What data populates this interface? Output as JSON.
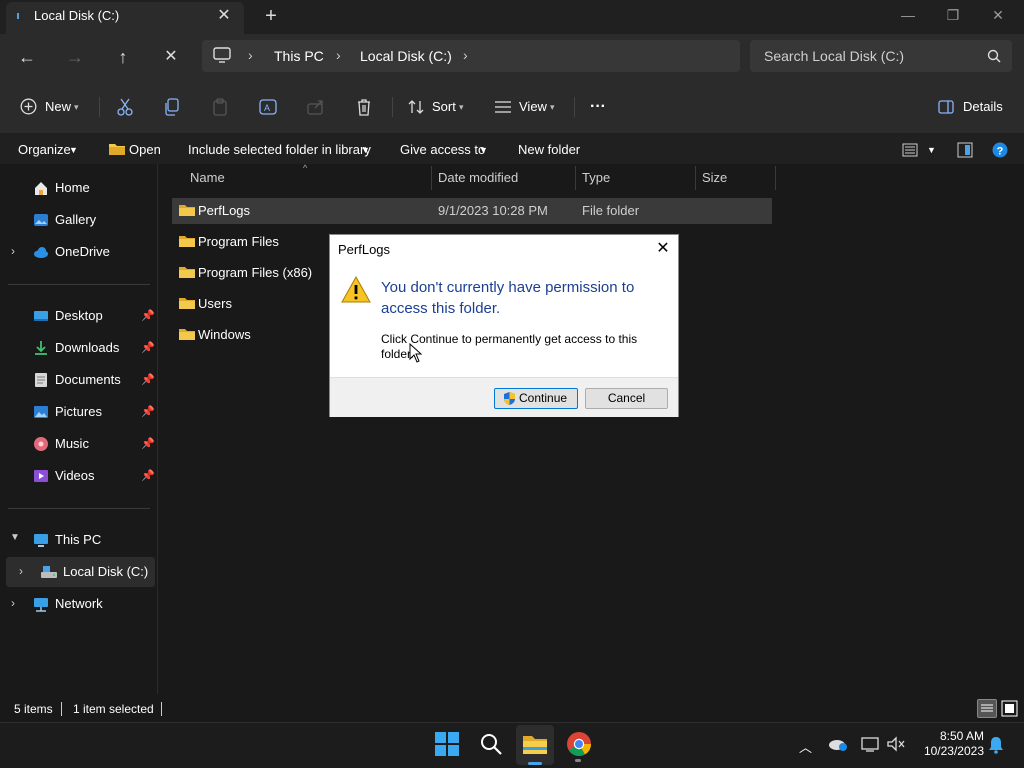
{
  "window": {
    "tab_title": "Local Disk (C:)",
    "new_tab": "+"
  },
  "address": {
    "crumbs": [
      "This PC",
      "Local Disk (C:)"
    ],
    "search_placeholder": "Search Local Disk (C:)"
  },
  "command_bar": {
    "new_label": "New",
    "sort_label": "Sort",
    "view_label": "View",
    "more_label": "···",
    "details_label": "Details"
  },
  "legacy_toolbar": {
    "organize": "Organize",
    "open": "Open",
    "include_in_library": "Include selected folder in library",
    "give_access": "Give access to",
    "new_folder": "New folder"
  },
  "sidebar": {
    "top": [
      {
        "label": "Home",
        "icon": "home-icon"
      },
      {
        "label": "Gallery",
        "icon": "gallery-icon"
      },
      {
        "label": "OneDrive",
        "icon": "onedrive-icon"
      }
    ],
    "pinned": [
      {
        "label": "Desktop",
        "icon": "desktop-icon"
      },
      {
        "label": "Downloads",
        "icon": "downloads-icon"
      },
      {
        "label": "Documents",
        "icon": "documents-icon"
      },
      {
        "label": "Pictures",
        "icon": "pictures-icon"
      },
      {
        "label": "Music",
        "icon": "music-icon"
      },
      {
        "label": "Videos",
        "icon": "videos-icon"
      }
    ],
    "tree": [
      {
        "label": "This PC",
        "icon": "this-pc-icon"
      },
      {
        "label": "Local Disk (C:)",
        "icon": "drive-icon"
      },
      {
        "label": "Network",
        "icon": "network-icon"
      }
    ]
  },
  "columns": {
    "name": "Name",
    "date": "Date modified",
    "type": "Type",
    "size": "Size"
  },
  "files": [
    {
      "name": "PerfLogs",
      "date": "9/1/2023 10:28 PM",
      "type": "File folder",
      "selected": true
    },
    {
      "name": "Program Files",
      "date": "",
      "type": ""
    },
    {
      "name": "Program Files (x86)",
      "date": "",
      "type": ""
    },
    {
      "name": "Users",
      "date": "",
      "type": ""
    },
    {
      "name": "Windows",
      "date": "",
      "type": ""
    }
  ],
  "dialog": {
    "title": "PerfLogs",
    "heading": "You don't currently have permission to access this folder.",
    "body": "Click Continue to permanently get access to this folder.",
    "continue_label": "Continue",
    "cancel_label": "Cancel"
  },
  "status": {
    "items": "5 items",
    "selected": "1 item selected"
  },
  "taskbar": {
    "time": "8:50 AM",
    "date": "10/23/2023"
  },
  "colors": {
    "accent": "#0078d4",
    "folder": "#f2c94c",
    "dialog_heading": "#1c3f94"
  }
}
